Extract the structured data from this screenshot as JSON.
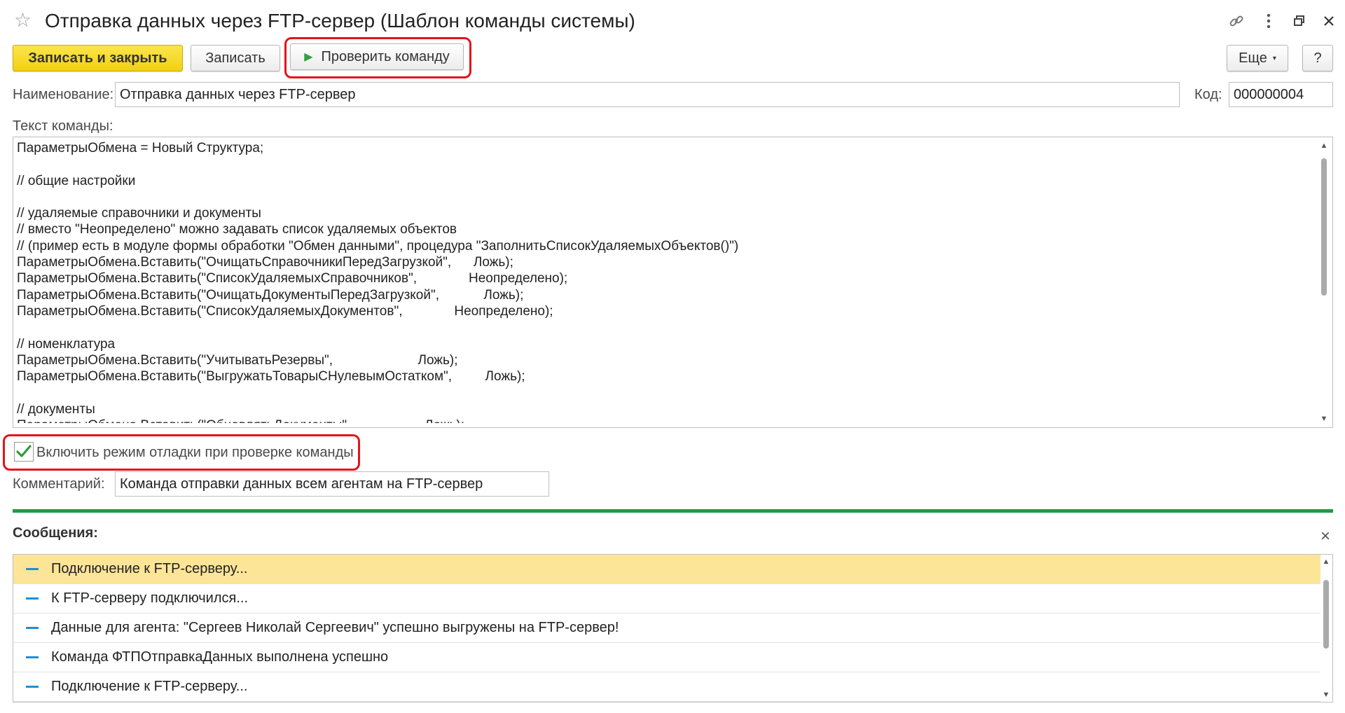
{
  "window": {
    "title": "Отправка данных через FTP-сервер (Шаблон команды системы)",
    "link_icon": "link-icon",
    "more_icon": "more-vertical-icon",
    "restore_icon": "restore-window-icon",
    "close_icon": "close-icon"
  },
  "toolbar": {
    "save_close": "Записать и закрыть",
    "save": "Записать",
    "check_command": "Проверить команду",
    "more": "Еще",
    "help": "?"
  },
  "fields": {
    "name_label": "Наименование:",
    "name_value": "Отправка данных через FTP-сервер",
    "code_label": "Код:",
    "code_value": "000000004",
    "command_text_label": "Текст команды:",
    "debug_label": "Включить режим отладки при проверке команды",
    "debug_checked": true,
    "comment_label": "Комментарий:",
    "comment_value": "Команда отправки данных всем агентам на FTP-сервер"
  },
  "command_text": [
    "ПараметрыОбмена = Новый Структура;",
    "",
    "// общие настройки",
    "",
    "// удаляемые справочники и документы",
    "// вместо \"Неопределено\" можно задавать список удаляемых объектов",
    "// (пример есть в модуле формы обработки \"Обмен данными\", процедура \"ЗаполнитьСписокУдаляемыхОбъектов()\")",
    "ПараметрыОбмена.Вставить(\"ОчищатьСправочникиПередЗагрузкой\",      Ложь);",
    "ПараметрыОбмена.Вставить(\"СписокУдаляемыхСправочников\",              Неопределено);",
    "ПараметрыОбмена.Вставить(\"ОчищатьДокументыПередЗагрузкой\",            Ложь);",
    "ПараметрыОбмена.Вставить(\"СписокУдаляемыхДокументов\",              Неопределено);",
    "",
    "// номенклатура",
    "ПараметрыОбмена.Вставить(\"УчитыватьРезервы\",                       Ложь);",
    "ПараметрыОбмена.Вставить(\"ВыгружатьТоварыСНулевымОстатком\",         Ложь);",
    "",
    "// документы",
    "ПараметрыОбмена.Вставить(\"ОбновлятьДокументы\",                    Ложь);"
  ],
  "messages": {
    "title": "Сообщения:",
    "items": [
      "Подключение к FTP-серверу...",
      "К FTP-серверу подключился...",
      "Данные для агента: \"Сергеев Николай Сергеевич\" успешно выгружены на FTP-сервер!",
      "Команда ФТПОтправкаДанных выполнена успешно",
      "Подключение к FTP-серверу..."
    ],
    "selected_index": 0
  },
  "colors": {
    "primary_button": "#f4d31c",
    "highlight": "#e3141b",
    "divider": "#1d9b47",
    "selected_row": "#fde597",
    "check": "#2e9b3a"
  }
}
